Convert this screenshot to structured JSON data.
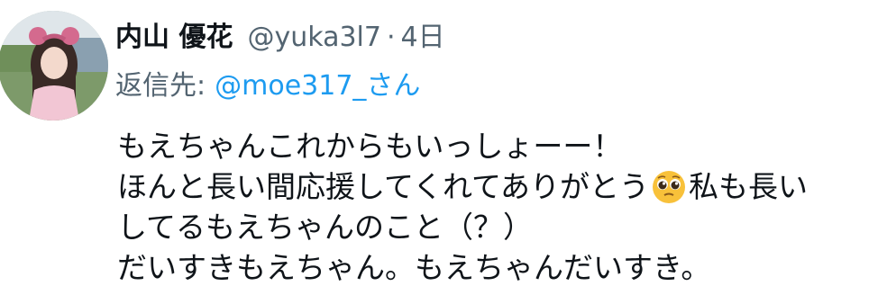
{
  "tweet": {
    "display_name": "内山 優花",
    "handle": "@yuka3l7",
    "separator": "·",
    "time": "4日",
    "reply_prefix": "返信先:",
    "reply_target": "@moe317_さん",
    "lines": [
      {
        "text": "もえちゃんこれからもいっしょーー！"
      },
      {
        "before": "ほんと長い間応援してくれてありがとう",
        "emoji": "pleading-face-icon",
        "after": "私も長い"
      },
      {
        "text": "してるもえちゃんのこと（？）"
      },
      {
        "text": "だいすきもえちゃん。もえちゃんだいすき。"
      }
    ]
  },
  "colors": {
    "name": "#0f1419",
    "muted": "#536471",
    "link": "#1d9bf0",
    "background": "#ffffff"
  }
}
